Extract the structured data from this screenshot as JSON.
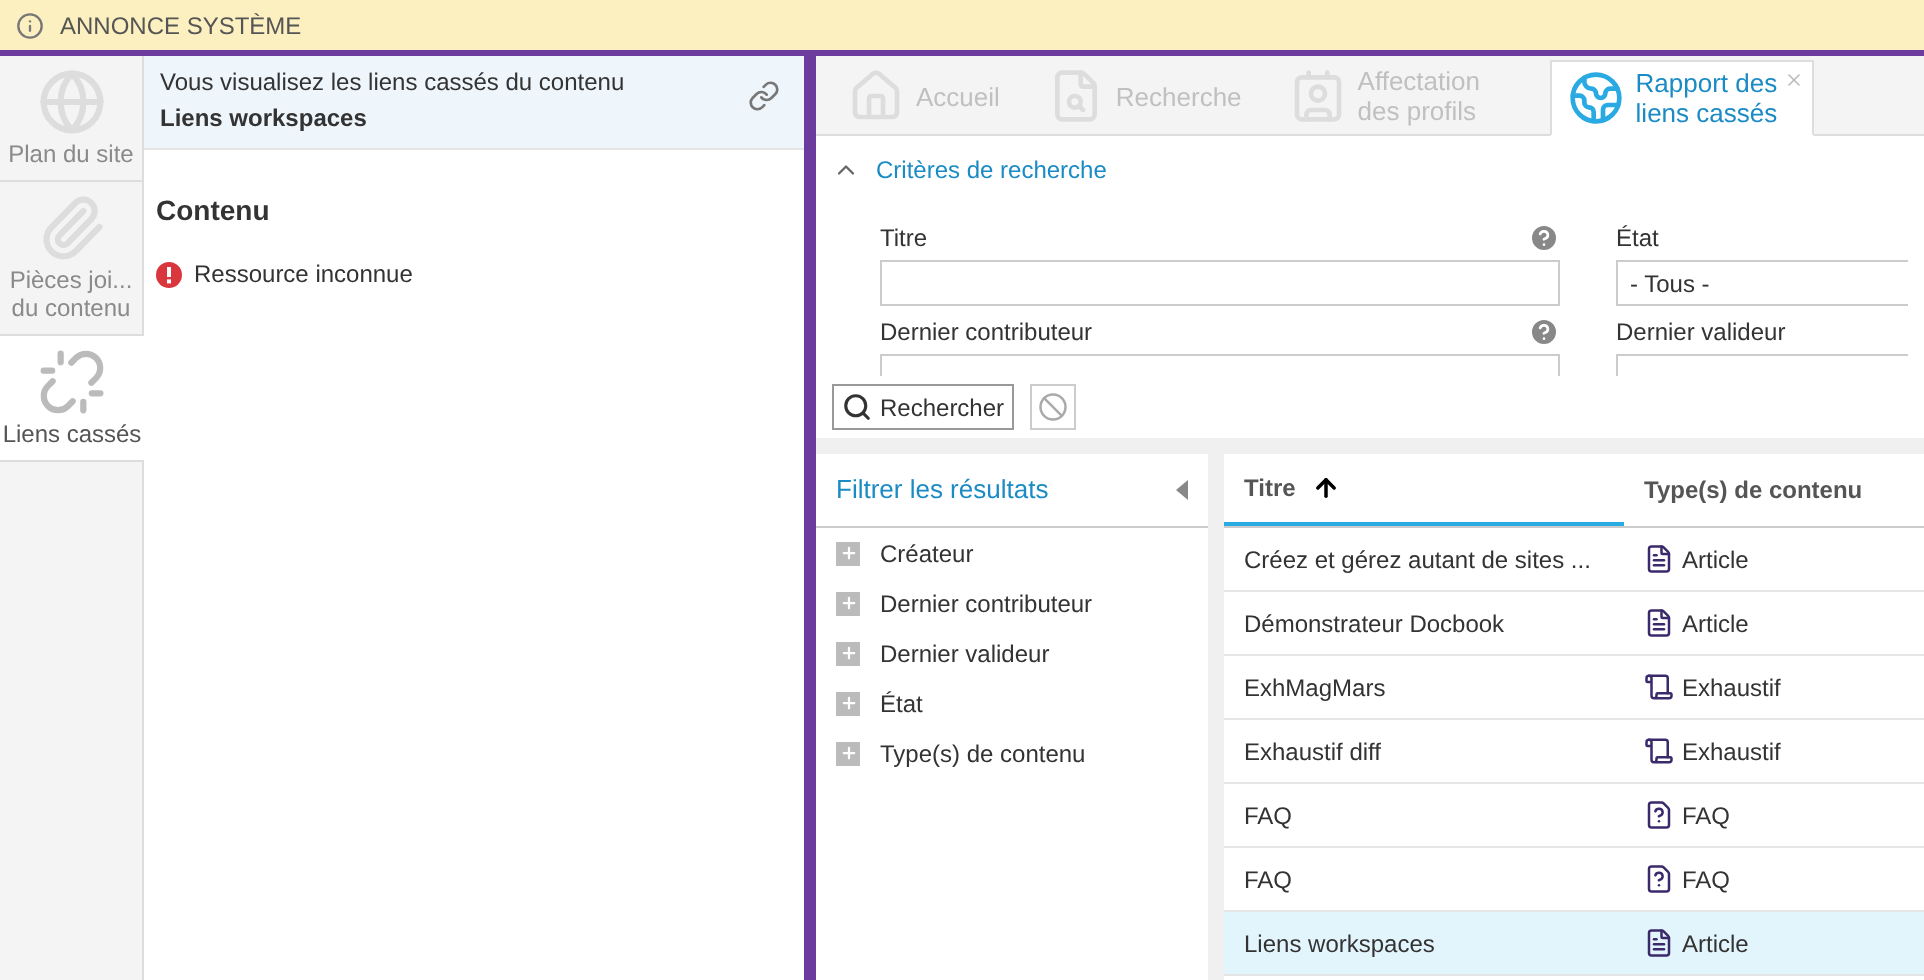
{
  "banner": {
    "title": "ANNONCE SYSTÈME"
  },
  "side_nav": [
    {
      "label": "Plan du site",
      "selected": false,
      "disabled": true
    },
    {
      "label": "Pièces joi... du contenu",
      "selected": false,
      "disabled": true
    },
    {
      "label": "Liens cassés",
      "selected": true,
      "disabled": false
    }
  ],
  "content_panel": {
    "intro": "Vous visualisez les liens cassés du contenu",
    "content_title": "Liens workspaces",
    "section": "Contenu",
    "errors": [
      "Ressource inconnue"
    ]
  },
  "tabs": [
    {
      "label": "Accueil",
      "selected": false,
      "closable": false
    },
    {
      "label": "Recherche",
      "selected": false,
      "closable": false
    },
    {
      "label": "Affectation des profils",
      "selected": false,
      "closable": false
    },
    {
      "label": "Rapport des liens cassés",
      "selected": true,
      "closable": true
    }
  ],
  "criteria": {
    "title": "Critères de recherche",
    "expanded": true,
    "fields": [
      {
        "label": "Titre",
        "help": true
      },
      {
        "label": "État",
        "help": false,
        "value": "- Tous -"
      },
      {
        "label": "Dernier contributeur",
        "help": true
      },
      {
        "label": "Dernier valideur",
        "help": false
      }
    ]
  },
  "buttons": {
    "search": "Rechercher"
  },
  "filters": {
    "title": "Filtrer les résultats",
    "items": [
      "Créateur",
      "Dernier contributeur",
      "Dernier valideur",
      "État",
      "Type(s) de contenu"
    ]
  },
  "table": {
    "columns": [
      "Titre",
      "Type(s) de contenu"
    ],
    "rows": [
      {
        "title": "Créez et gérez autant de sites ...",
        "type": "Article",
        "kind": "article",
        "selected": false
      },
      {
        "title": "Démonstrateur Docbook",
        "type": "Article",
        "kind": "article",
        "selected": false
      },
      {
        "title": "ExhMagMars",
        "type": "Exhaustif",
        "kind": "exhaustive",
        "selected": false
      },
      {
        "title": "Exhaustif diff",
        "type": "Exhaustif",
        "kind": "exhaustive",
        "selected": false
      },
      {
        "title": "FAQ",
        "type": "FAQ",
        "kind": "faq",
        "selected": false
      },
      {
        "title": "FAQ",
        "type": "FAQ",
        "kind": "faq",
        "selected": false
      },
      {
        "title": "Liens workspaces",
        "type": "Article",
        "kind": "article",
        "selected": true
      }
    ]
  }
}
